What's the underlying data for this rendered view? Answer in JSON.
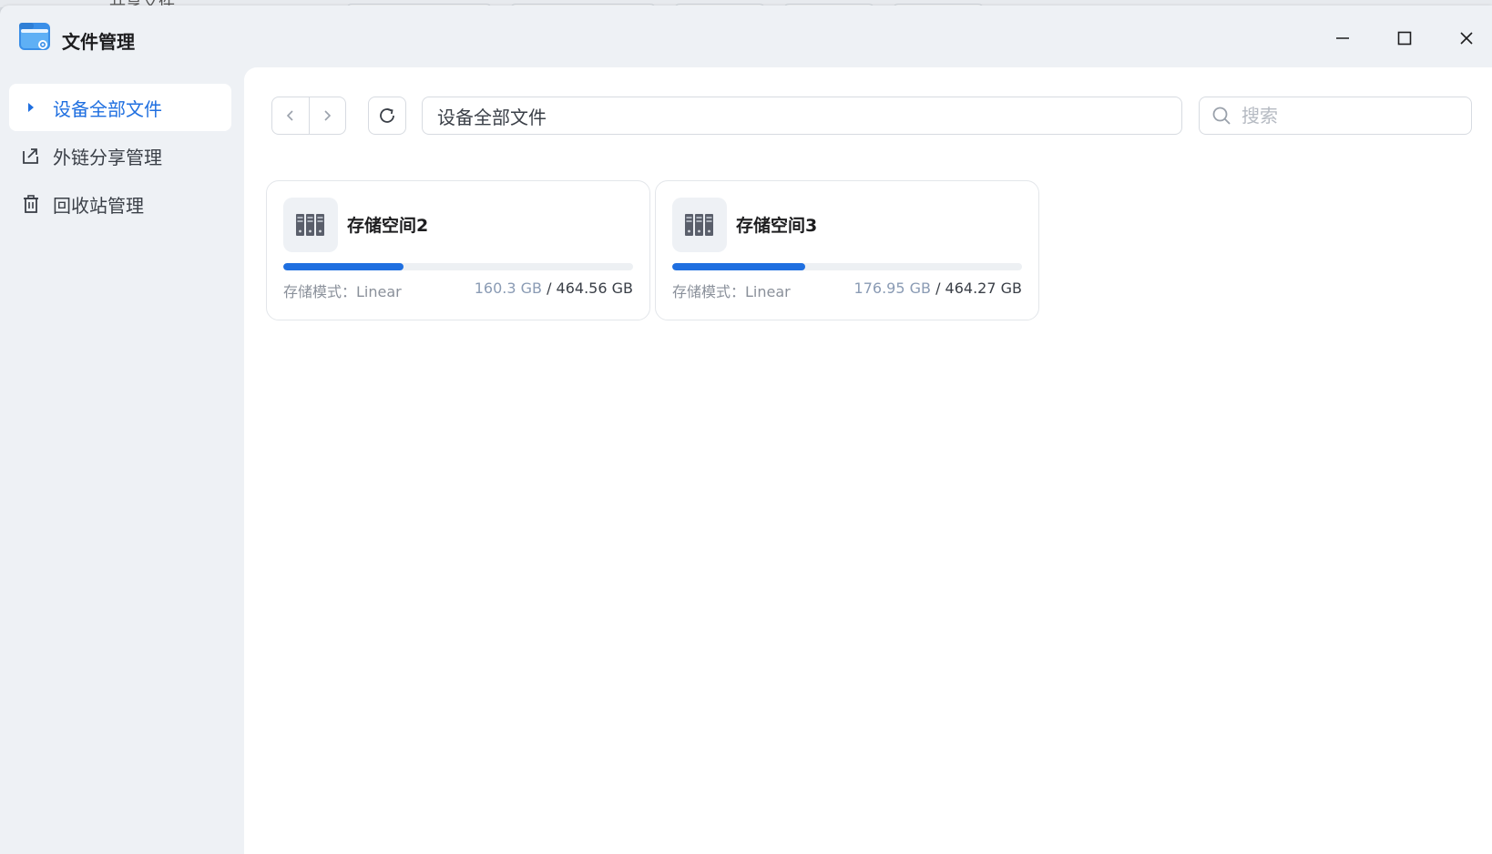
{
  "background": {
    "ghost_text": "共享文件"
  },
  "window": {
    "title": "文件管理",
    "icons": {
      "app": "folder-gear-icon",
      "minimize": "minimize-icon",
      "maximize": "maximize-icon",
      "close": "close-icon"
    }
  },
  "sidebar": {
    "items": [
      {
        "label": "设备全部文件",
        "icon": "caret-right-icon",
        "active": true
      },
      {
        "label": "外链分享管理",
        "icon": "share-icon",
        "active": false
      },
      {
        "label": "回收站管理",
        "icon": "trash-icon",
        "active": false
      }
    ]
  },
  "toolbar": {
    "path": "设备全部文件",
    "search_placeholder": "搜索"
  },
  "storages": [
    {
      "name": "存储空间2",
      "mode": "存储模式：Linear",
      "used": "160.3 GB",
      "separator": " / ",
      "total": "464.56 GB",
      "usage_fraction": 0.345
    },
    {
      "name": "存储空间3",
      "mode": "存储模式：Linear",
      "used": "176.95 GB",
      "separator": " / ",
      "total": "464.27 GB",
      "usage_fraction": 0.381
    }
  ],
  "colors": {
    "accent": "#1f6fe0",
    "sidebar_bg": "#eef1f5",
    "content_bg": "#ffffff"
  }
}
